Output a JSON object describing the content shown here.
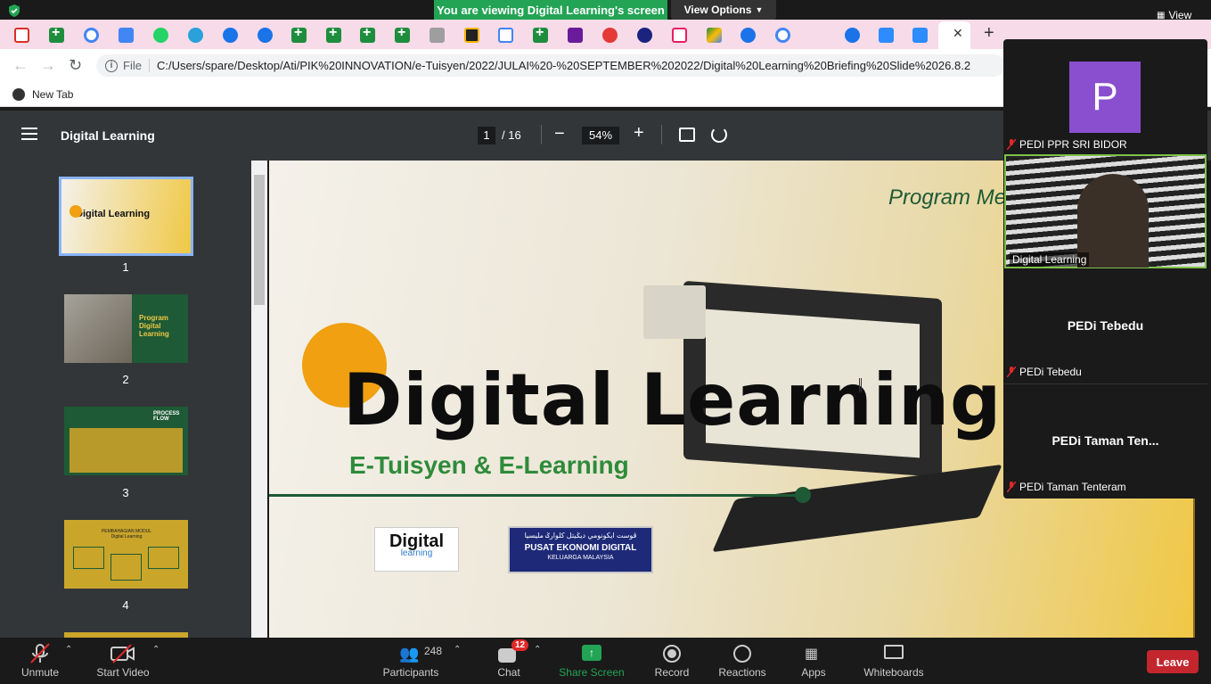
{
  "zoom_top": {
    "viewing_banner": "You are viewing Digital Learning's screen",
    "view_options": "View Options",
    "view_label": "View"
  },
  "browser": {
    "url_scheme": "File",
    "url": "C:/Users/spare/Desktop/Ati/PIK%20INNOVATION/e-Tuisyen/2022/JULAI%20-%20SEPTEMBER%202022/Digital%20Learning%20Briefing%20Slide%2026.8.2",
    "bookmark_new_tab": "New Tab"
  },
  "pdf": {
    "title": "Digital Learning",
    "current_page": "1",
    "total_pages": "/ 16",
    "zoom": "54%",
    "thumbnails": [
      {
        "num": "1",
        "label": "Digital Learning"
      },
      {
        "num": "2",
        "label": "Program Digital Learning"
      },
      {
        "num": "3",
        "label": "PROCESS FLOW"
      },
      {
        "num": "4",
        "label": "PEMBAHAGIAN MODUL Digital Learning"
      }
    ]
  },
  "slide": {
    "header_text": "Program Me",
    "title": "Digital Learning",
    "subtitle": "E-Tuisyen & E-Learning",
    "logo_digital": "Digital",
    "logo_learning": "learning",
    "logo_pusat_arabic": "ڤوست ايكونومي ديݢيتل كلوارݢ مليسيا",
    "logo_pusat_main": "PUSAT EKONOMI DIGITAL",
    "logo_pusat_sub": "KELUARGA MALAYSIA"
  },
  "participants": [
    {
      "name": "PEDI PPR SRI BIDOR",
      "avatar_letter": "P",
      "muted": true
    },
    {
      "name": "Digital Learning",
      "muted": false
    },
    {
      "name": "PEDi Tebedu",
      "display": "PEDi Tebedu",
      "muted": true
    },
    {
      "name": "PEDi Taman Tenteram",
      "display": "PEDi Taman Ten...",
      "muted": true
    }
  ],
  "bottom": {
    "unmute": "Unmute",
    "start_video": "Start Video",
    "participants": "Participants",
    "participants_count": "248",
    "chat": "Chat",
    "chat_badge": "12",
    "share_screen": "Share Screen",
    "record": "Record",
    "reactions": "Reactions",
    "apps": "Apps",
    "whiteboards": "Whiteboards",
    "leave": "Leave"
  },
  "colors": {
    "share_green": "#23a455",
    "leave_red": "#c4262e",
    "slide_green": "#2e8b3a",
    "slide_orange": "#f0a010",
    "avatar_purple": "#8a4fcf"
  }
}
